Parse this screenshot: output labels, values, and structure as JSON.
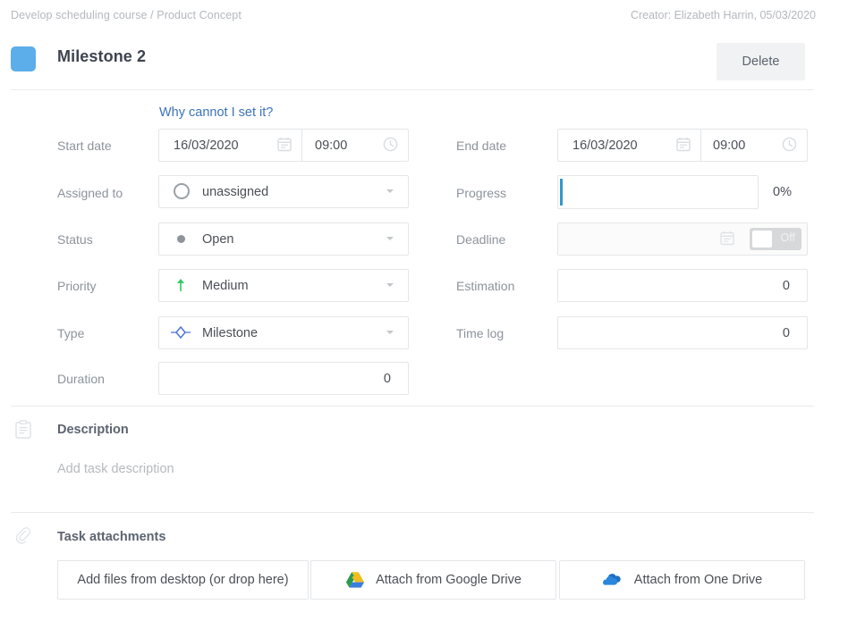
{
  "header": {
    "breadcrumb": "Develop scheduling course / Product Concept",
    "creator": "Creator: Elizabeth Harrin, 05/03/2020",
    "task_title": "Milestone 2",
    "delete_label": "Delete",
    "swatch_color": "#5BAEEA"
  },
  "form": {
    "why_link": "Why cannot I set it?",
    "start_date": {
      "label": "Start date",
      "date": "16/03/2020",
      "time": "09:00",
      "date_icon": "calendar-icon",
      "time_icon": "clock-icon"
    },
    "end_date": {
      "label": "End date",
      "date": "16/03/2020",
      "time": "09:00",
      "date_icon": "calendar-icon",
      "time_icon": "clock-icon"
    },
    "assigned_to": {
      "label": "Assigned to",
      "value": "unassigned",
      "icon": "empty-avatar-icon"
    },
    "progress": {
      "label": "Progress",
      "value": "",
      "percent": "0%"
    },
    "status": {
      "label": "Status",
      "value": "Open",
      "icon": "status-dot-icon",
      "icon_color": "#8e949c"
    },
    "deadline": {
      "label": "Deadline",
      "value": "",
      "toggle_state": "Off",
      "icon": "calendar-icon"
    },
    "priority": {
      "label": "Priority",
      "value": "Medium",
      "icon": "arrow-up-icon",
      "icon_color": "#2ecc63"
    },
    "estimation": {
      "label": "Estimation",
      "value": "0"
    },
    "type": {
      "label": "Type",
      "value": "Milestone",
      "icon": "milestone-diamond-icon",
      "icon_color": "#4a74d8"
    },
    "time_log": {
      "label": "Time log",
      "value": "0"
    },
    "duration": {
      "label": "Duration",
      "value": "0"
    }
  },
  "description": {
    "title": "Description",
    "icon": "clipboard-icon",
    "placeholder": "Add task description"
  },
  "attachments": {
    "title": "Task attachments",
    "icon": "paperclip-icon",
    "buttons": [
      {
        "label": "Add files from desktop (or drop here)",
        "icon": "none"
      },
      {
        "label": "Attach from Google Drive",
        "icon": "google-drive-icon"
      },
      {
        "label": "Attach from One Drive",
        "icon": "one-drive-icon"
      }
    ]
  }
}
